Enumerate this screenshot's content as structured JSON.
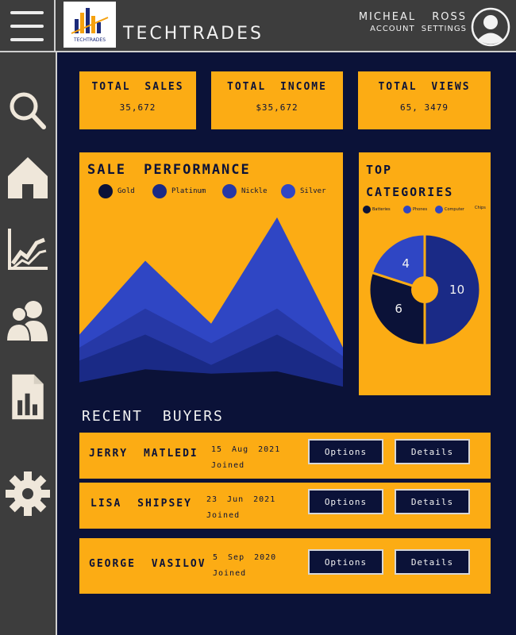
{
  "header": {
    "brand": "TECHTRADES",
    "logo_text": "TECHTRADES",
    "user_name": "MICHEAL ROSS",
    "account_settings": "ACCOUNT SETTINGS"
  },
  "sidebar": {
    "items": [
      {
        "icon": "search-icon"
      },
      {
        "icon": "home-icon"
      },
      {
        "icon": "analytics-icon"
      },
      {
        "icon": "users-icon"
      },
      {
        "icon": "reports-icon"
      },
      {
        "icon": "settings-icon"
      }
    ]
  },
  "kpis": [
    {
      "title": "TOTAL SALES",
      "value": "35,672"
    },
    {
      "title": "TOTAL INCOME",
      "value": "$35,672"
    },
    {
      "title": "TOTAL VIEWS",
      "value": "65, 3479"
    }
  ],
  "chart_data": [
    {
      "type": "area",
      "title": "SALE PERFORMANCE",
      "xlabel": "",
      "ylabel": "",
      "grid": false,
      "legend_position": "top",
      "series": [
        {
          "name": "Silver",
          "color": "#2f46c4",
          "values": [
            28,
            62,
            33,
            82,
            22
          ]
        },
        {
          "name": "Nickle",
          "color": "#2638a6",
          "values": [
            22,
            40,
            24,
            40,
            18
          ]
        },
        {
          "name": "Platinum",
          "color": "#1a2a86",
          "values": [
            16,
            28,
            14,
            28,
            12
          ]
        },
        {
          "name": "Gold",
          "color": "#0b1238",
          "values": [
            6,
            12,
            10,
            11,
            4
          ]
        }
      ]
    },
    {
      "type": "pie",
      "title": "TOP CATEGORIES",
      "legend_position": "top",
      "legend": [
        {
          "label": "Batteries",
          "color": "#0b1238"
        },
        {
          "label": "Phones",
          "color": "#2f46c4"
        },
        {
          "label": "Computer",
          "color": "#2f46c4"
        },
        {
          "label": "Chips",
          "color": "#fcac14"
        }
      ],
      "slices": [
        {
          "value": 10,
          "label": "10",
          "color": "#1a2a86"
        },
        {
          "value": 6,
          "label": "6",
          "color": "#0b1238"
        },
        {
          "value": 4,
          "label": "4",
          "color": "#2f46c4"
        }
      ]
    }
  ],
  "recent_buyers": {
    "title": "RECENT BUYERS",
    "rows": [
      {
        "name": "JERRY MATLEDI",
        "date": "15 Aug 2021",
        "joined": "Joined",
        "options": "Options",
        "details": "Details"
      },
      {
        "name": "LISA SHIPSEY",
        "date": "23 Jun 2021",
        "joined": "Joined",
        "options": "Options",
        "details": "Details"
      },
      {
        "name": "GEORGE VASILOV",
        "date": "5 Sep 2020",
        "joined": "Joined",
        "options": "Options",
        "details": "Details"
      }
    ]
  },
  "colors": {
    "background": "#0b1238",
    "accent": "#fcac14",
    "bar": "#3d3d3d"
  }
}
